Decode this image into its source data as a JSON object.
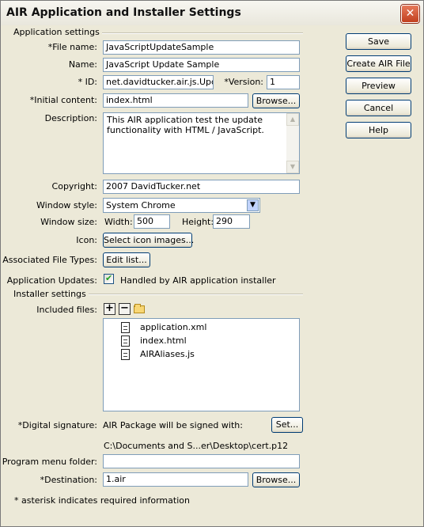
{
  "window": {
    "title": "AIR Application and Installer Settings",
    "close_glyph": "✕"
  },
  "buttons": {
    "save": "Save",
    "create_air": "Create AIR File",
    "preview": "Preview",
    "cancel": "Cancel",
    "help": "Help"
  },
  "app_settings": {
    "group_title": "Application settings",
    "file_name_label": "*File name:",
    "file_name_value": "JavaScriptUpdateSample",
    "name_label": "Name:",
    "name_value": "JavaScript Update Sample",
    "id_label": "* ID:",
    "id_value": "net.davidtucker.air.js.Update",
    "version_label": "*Version:",
    "version_value": "1",
    "initial_content_label": "*Initial content:",
    "initial_content_value": "index.html",
    "browse_label": "Browse...",
    "description_label": "Description:",
    "description_value": "This AIR application test the update functionality with HTML / JavaScript.",
    "copyright_label": "Copyright:",
    "copyright_value": "2007 DavidTucker.net",
    "window_style_label": "Window style:",
    "window_style_value": "System Chrome",
    "window_size_label": "Window size:",
    "width_label": "Width:",
    "width_value": "500",
    "height_label": "Height:",
    "height_value": "290",
    "icon_label": "Icon:",
    "icon_button": "Select icon images...",
    "file_types_label": "Associated File Types:",
    "file_types_button": "Edit list...",
    "updates_label": "Application Updates:",
    "updates_checkbox_label": "Handled by AIR application installer",
    "updates_checked": true
  },
  "installer_settings": {
    "group_title": "Installer settings",
    "included_files_label": "Included files:",
    "add_glyph": "+",
    "remove_glyph": "−",
    "files": [
      "application.xml",
      "index.html",
      "AIRAliases.js"
    ],
    "signature_label": "*Digital signature:",
    "signature_text": "AIR Package will be signed with:",
    "set_button": "Set...",
    "cert_path": "C:\\Documents and S...er\\Desktop\\cert.p12",
    "program_menu_label": "Program menu folder:",
    "program_menu_value": "",
    "destination_label": "*Destination:",
    "destination_value": "1.air",
    "destination_browse": "Browse..."
  },
  "footer_note": "* asterisk indicates required information",
  "colors": {
    "input_border": "#7f9db9",
    "button_border": "#003c74",
    "window_bg": "#ece9d8",
    "close_button": "#c2401f"
  }
}
